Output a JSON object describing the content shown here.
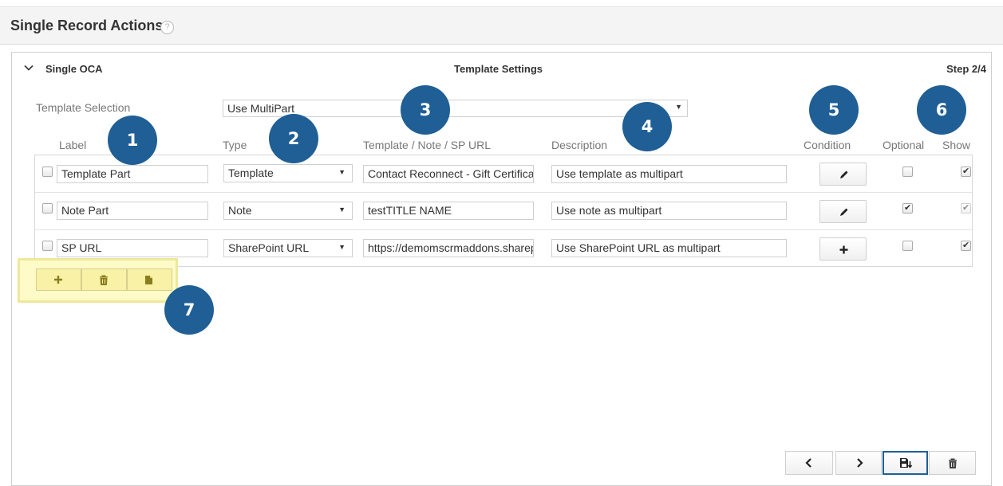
{
  "page": {
    "title": "Single Record Actions",
    "help_icon": "?"
  },
  "panel": {
    "name": "Single OCA",
    "header_center": "Template Settings",
    "step": "Step 2/4",
    "template_selection": {
      "label": "Template Selection",
      "value": "Use MultiPart"
    },
    "columns": {
      "label": "Label",
      "type": "Type",
      "template": "Template / Note / SP URL",
      "description": "Description",
      "condition": "Condition",
      "optional": "Optional",
      "show": "Show"
    },
    "rows": [
      {
        "label": "Template Part",
        "type": "Template",
        "value": "Contact Reconnect - Gift Certificate",
        "description": "Use template as multipart",
        "condition_icon": "pencil-icon",
        "selected": false,
        "optional": false,
        "show": true,
        "show_disabled": false
      },
      {
        "label": "Note Part",
        "type": "Note",
        "value": "testTITLE NAME",
        "description": "Use note as multipart",
        "condition_icon": "pencil-icon",
        "selected": false,
        "optional": true,
        "show": true,
        "show_disabled": true
      },
      {
        "label": "SP URL",
        "type": "SharePoint URL",
        "value": "https://demomscrmaddons.sharepoint.com",
        "description": "Use SharePoint URL as multipart",
        "condition_icon": "plus-icon",
        "selected": false,
        "optional": false,
        "show": true,
        "show_disabled": false
      }
    ],
    "action_icons": [
      "plus-icon",
      "trash-icon",
      "file-icon"
    ],
    "nav_icons": [
      "chevron-left-icon",
      "chevron-right-icon",
      "save-icon",
      "trash-icon"
    ]
  },
  "callouts": [
    "1",
    "2",
    "3",
    "4",
    "5",
    "6",
    "7"
  ],
  "colors": {
    "badge": "#1f5f96",
    "highlight": "#fffbc8",
    "highlight_border": "#efe89b",
    "action_icon": "#8a7d1e"
  }
}
